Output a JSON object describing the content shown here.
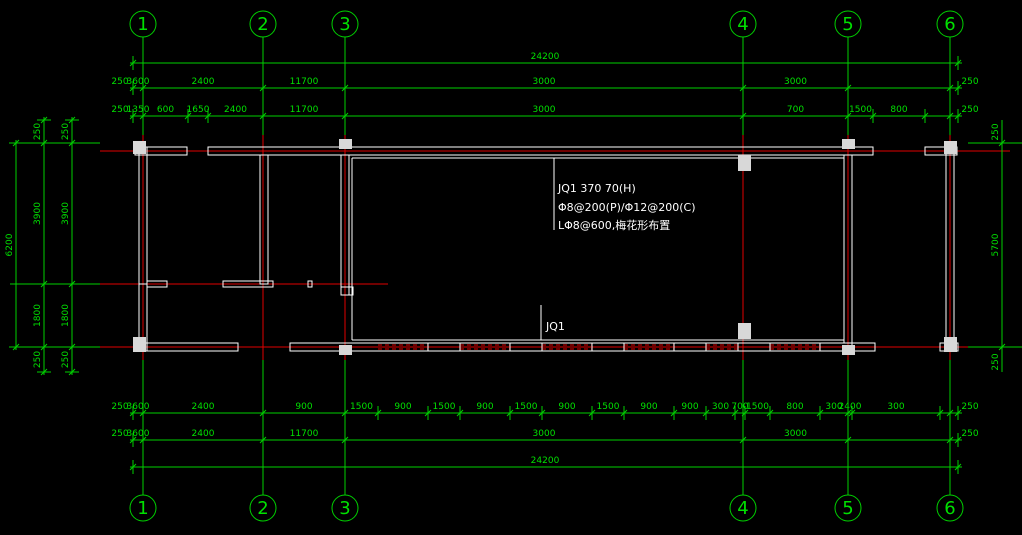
{
  "axes": [
    "1",
    "2",
    "3",
    "4",
    "5",
    "6"
  ],
  "top_dims": {
    "row1": [
      "250",
      "1350",
      "600",
      "1650",
      "2400",
      "11700",
      "3000",
      "700",
      "1500",
      "800",
      "250"
    ],
    "row2": [
      "250",
      "3600",
      "2400",
      "11700",
      "3000",
      "3000",
      "250"
    ],
    "total": "24200"
  },
  "bottom_dims": {
    "row1": [
      "250",
      "3600",
      "2400",
      "900",
      "1500",
      "900",
      "1500",
      "900",
      "1500",
      "900",
      "1500",
      "900",
      "900",
      "300",
      "700",
      "1500",
      "800",
      "300",
      "2400",
      "300",
      "250"
    ],
    "row2": [
      "250",
      "3600",
      "2400",
      "11700",
      "3000",
      "3000",
      "250"
    ],
    "total": "24200"
  },
  "left_dims": {
    "total": "6200",
    "outer": [
      "250",
      "3900",
      "1800",
      "250"
    ],
    "inner": [
      "250",
      "3900",
      "1800",
      "250"
    ]
  },
  "right_dims": {
    "total": "5700",
    "outer": [
      "250",
      "250"
    ]
  },
  "annotations": {
    "beam_line1": "JQ1 370  70(H)",
    "beam_line2": "Φ8@200(P)/Φ12@200(C)",
    "beam_line3": "LΦ8@600,梅花形布置",
    "beam_tag": "JQ1"
  },
  "colors": {
    "dimension": "#00d000",
    "axis_line": "#e00000",
    "wall": "#ffffff",
    "column": "#d8d8d8",
    "background": "#000000"
  }
}
